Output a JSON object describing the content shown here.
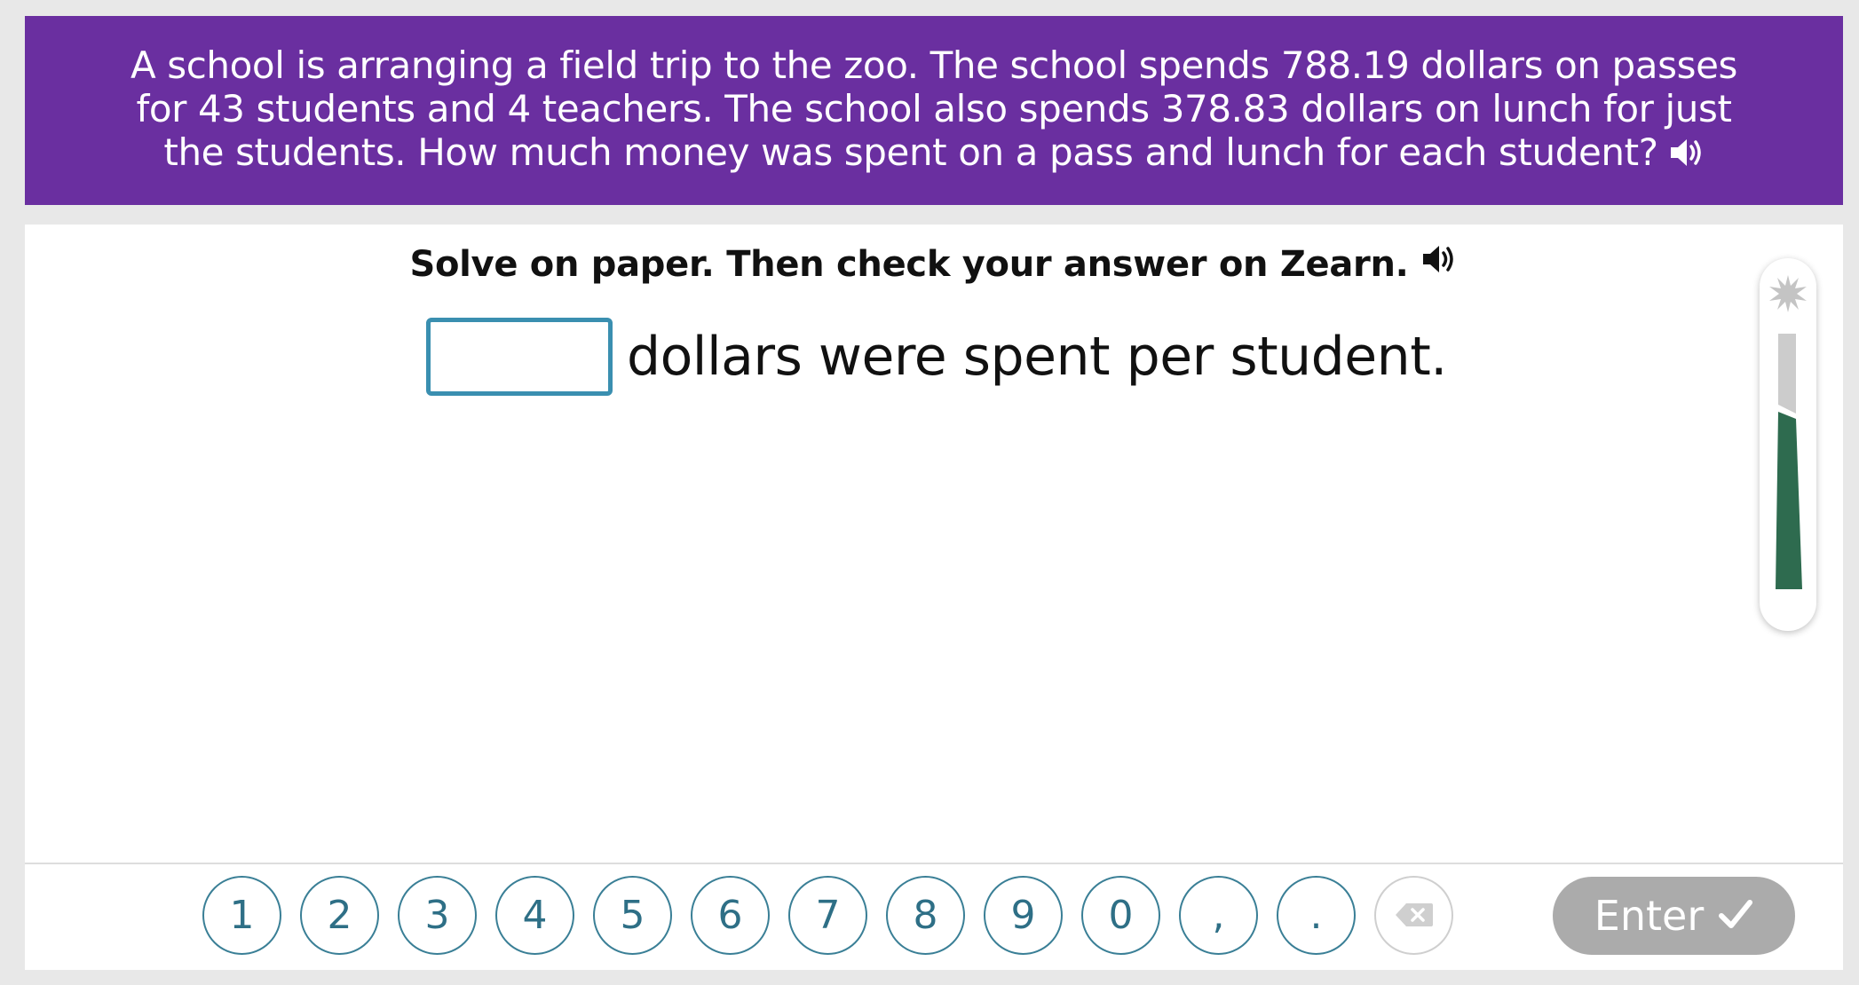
{
  "question": {
    "text": "A school is arranging a field trip to the zoo. The school spends 788.19 dollars on passes for 43 students and 4 teachers. The school also spends 378.83 dollars on lunch for just the students. How much money was spent on a pass and lunch for each student?",
    "speaker_icon": "speaker-icon",
    "background_color": "#6a2fa0"
  },
  "instruction": {
    "text": "Solve on paper. Then check your answer on Zearn.",
    "speaker_icon": "speaker-icon"
  },
  "answer": {
    "value": "",
    "suffix": "dollars were spent per student.",
    "border_color": "#3a8fb0"
  },
  "progress": {
    "star_icon": "star-burst-icon",
    "filled_color": "#2e6b4f",
    "empty_color": "#cccccc"
  },
  "keypad": {
    "keys": [
      "1",
      "2",
      "3",
      "4",
      "5",
      "6",
      "7",
      "8",
      "9",
      "0",
      ",",
      "."
    ],
    "backspace_icon": "backspace-icon",
    "key_color": "#2e6f86"
  },
  "enter": {
    "label": "Enter",
    "icon": "checkmark-icon",
    "background_color": "#ababab"
  }
}
